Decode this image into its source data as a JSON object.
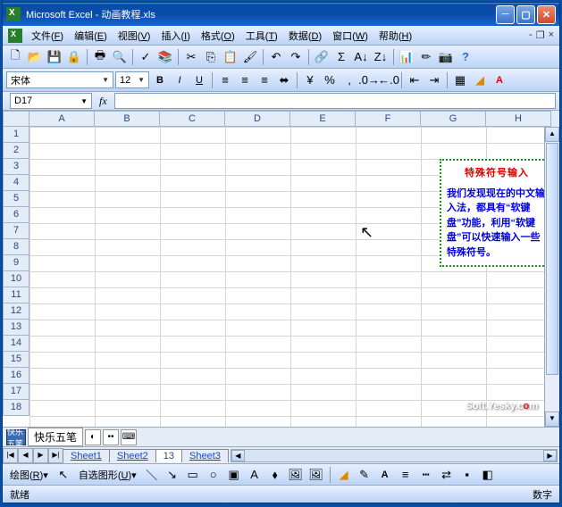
{
  "title": "Microsoft Excel - 动画教程.xls",
  "menu": {
    "file": "文件",
    "edit": "编辑",
    "view": "视图",
    "insert": "插入",
    "format": "格式",
    "tools": "工具",
    "data": "数据",
    "window": "窗口",
    "help": "帮助",
    "file_k": "F",
    "edit_k": "E",
    "view_k": "V",
    "insert_k": "I",
    "format_k": "O",
    "tools_k": "T",
    "data_k": "D",
    "window_k": "W",
    "help_k": "H"
  },
  "format": {
    "font": "宋体",
    "size": "12"
  },
  "namebox": "D17",
  "columns": [
    "A",
    "B",
    "C",
    "D",
    "E",
    "F",
    "G",
    "H"
  ],
  "rows": [
    "1",
    "2",
    "3",
    "4",
    "5",
    "6",
    "7",
    "8",
    "9",
    "10",
    "11",
    "12",
    "13",
    "14",
    "15",
    "16",
    "17",
    "18"
  ],
  "callout": {
    "title": "特殊符号输入",
    "body": "我们发现现在的中文输入法，都具有“软键盘”功能，利用“软键盘”可以快速输入一些特殊符号。"
  },
  "watermark": {
    "pre": "Soft.Yesky.c",
    "o": "o",
    "post": "m"
  },
  "ime": {
    "label": "快乐五笔",
    "icon": "快乐五笔"
  },
  "sheets": {
    "s1": "Sheet1",
    "s2": "Sheet2",
    "s3": "13",
    "s4": "Sheet3"
  },
  "drawing": {
    "label": "绘图",
    "au": "自选图形",
    "k1": "R",
    "k2": "U"
  },
  "status": {
    "ready": "就绪",
    "num": "数字"
  }
}
